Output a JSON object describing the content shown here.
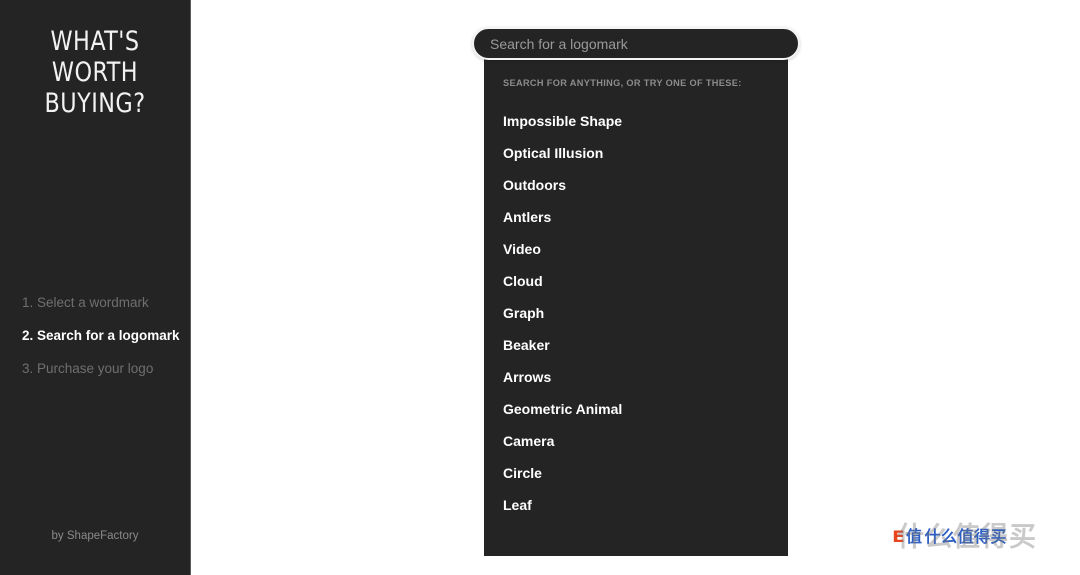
{
  "sidebar": {
    "brand": {
      "line1": "What's",
      "line2": "Worth",
      "line3": "Buying?"
    },
    "steps": [
      {
        "label": "1. Select a wordmark",
        "state": "done"
      },
      {
        "label": "2. Search for a logomark",
        "state": "active"
      },
      {
        "label": "3. Purchase your logo",
        "state": "pending"
      }
    ],
    "credit": "by ShapeFactory"
  },
  "search": {
    "placeholder": "Search for a logomark",
    "value": ""
  },
  "dropdown": {
    "header": "SEARCH FOR ANYTHING, OR TRY ONE OF THESE:",
    "suggestions": [
      "Impossible Shape",
      "Optical Illusion",
      "Outdoors",
      "Antlers",
      "Video",
      "Cloud",
      "Graph",
      "Beaker",
      "Arrows",
      "Geometric Animal",
      "Camera",
      "Circle",
      "Leaf"
    ]
  },
  "watermark": {
    "mark": "E",
    "text": "值",
    "ghost": "什么值得买",
    "overlay": "什么值得买"
  },
  "colors": {
    "panel": "#242424",
    "sidebar": "#242424",
    "page": "#ffffff",
    "active_text": "#ffffff",
    "muted_text": "#6f6f6f",
    "watermark_red": "#e8451f",
    "watermark_blue": "#2d5fc4"
  }
}
